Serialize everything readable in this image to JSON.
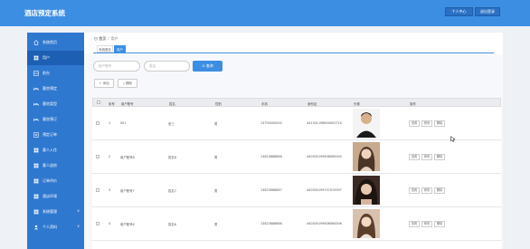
{
  "app": {
    "title": "酒店预定系统"
  },
  "header": {
    "personal_center": "个人中心",
    "logout": "退出登录"
  },
  "sidebar": {
    "items": [
      {
        "label": "系统首页",
        "icon": "home-icon"
      },
      {
        "label": "用户",
        "icon": "grid-icon",
        "active": true
      },
      {
        "label": "前台",
        "icon": "grid-icon"
      },
      {
        "label": "客房预定",
        "icon": "bed-icon"
      },
      {
        "label": "客房类型",
        "icon": "bed-icon"
      },
      {
        "label": "客房预订",
        "icon": "bed-icon"
      },
      {
        "label": "预定订单",
        "icon": "grid-icon"
      },
      {
        "label": "客人入住",
        "icon": "grid-icon"
      },
      {
        "label": "客人退房",
        "icon": "grid-icon"
      },
      {
        "label": "订单评价",
        "icon": "grid-icon"
      },
      {
        "label": "酒店环境",
        "icon": "grid-icon"
      },
      {
        "label": "系统管理",
        "icon": "grid-icon",
        "expand": "∨"
      },
      {
        "label": "个人资料",
        "icon": "user-icon",
        "expand": "∨"
      }
    ]
  },
  "breadcrumb": {
    "home": "首页",
    "sep": "/",
    "current": "用户"
  },
  "tabs": [
    {
      "label": "系统首页"
    },
    {
      "label": "用户",
      "active": true
    }
  ],
  "search": {
    "account_placeholder": "用户账号",
    "name_placeholder": "姓名",
    "query_label": "查询"
  },
  "actions": {
    "add_label": "+ 添加",
    "delete_label": "删除"
  },
  "table": {
    "columns": [
      "",
      "序号",
      "用户账号",
      "姓名",
      "性别",
      "手机",
      "身份证",
      "头像",
      "操作"
    ],
    "rows": [
      {
        "index": "1",
        "account": "001",
        "name": "张三",
        "gender": "男",
        "phone": "13700000000",
        "idcard": "44130119880000271X"
      },
      {
        "index": "2",
        "account": "用户账号8",
        "name": "姓名8",
        "gender": "男",
        "phone": "13823888888",
        "idcard": "440300199808080000"
      },
      {
        "index": "3",
        "account": "用户账号7",
        "name": "姓名7",
        "gender": "男",
        "phone": "13823888887",
        "idcard": "440300199707070007"
      },
      {
        "index": "4",
        "account": "用户账号6",
        "name": "姓名6",
        "gender": "男",
        "phone": "13823888886",
        "idcard": "440300199606060006"
      }
    ],
    "row_actions": [
      "查看",
      "修改",
      "删除"
    ]
  }
}
